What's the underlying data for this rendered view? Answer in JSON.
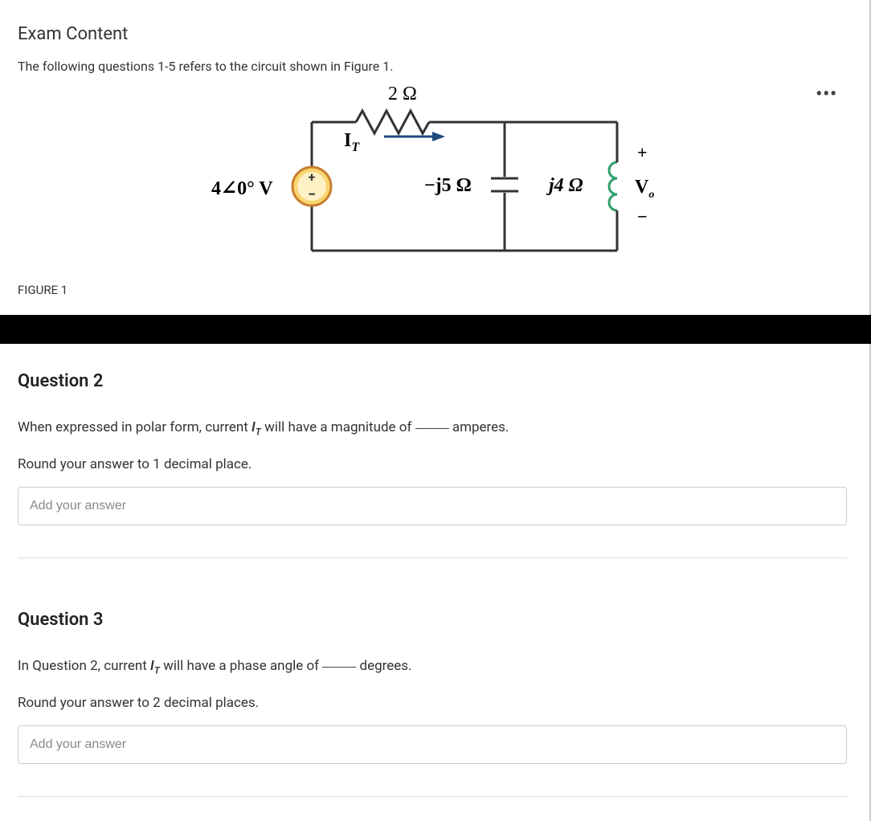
{
  "header": {
    "title": "Exam Content",
    "intro": "The following questions 1-5 refers to the circuit shown in Figure 1.",
    "figure_caption": "FIGURE 1"
  },
  "circuit": {
    "resistor_label": "2 Ω",
    "current_label": "I",
    "current_sub": "T",
    "source_label": "4∠0° V",
    "capacitor_label": "−j5 Ω",
    "inductor_label": "j4 Ω",
    "vo_plus": "+",
    "vo_label": "V",
    "vo_sub": "o",
    "vo_minus": "−",
    "src_plus": "+",
    "src_minus": "−"
  },
  "questions": [
    {
      "title": "Question 2",
      "text_prefix": "When expressed in polar form, current ",
      "current_sym": "I",
      "current_sub": "T",
      "text_mid": " will have a magnitude of ",
      "text_suffix": " amperes.",
      "round_note": "Round your answer to 1 decimal place.",
      "placeholder": "Add your answer"
    },
    {
      "title": "Question 3",
      "text_prefix": "In Question 2, current ",
      "current_sym": "I",
      "current_sub": "T",
      "text_mid": " will have a phase angle of ",
      "text_suffix": " degrees.",
      "round_note": "Round your answer to 2 decimal places.",
      "placeholder": "Add your answer"
    }
  ]
}
